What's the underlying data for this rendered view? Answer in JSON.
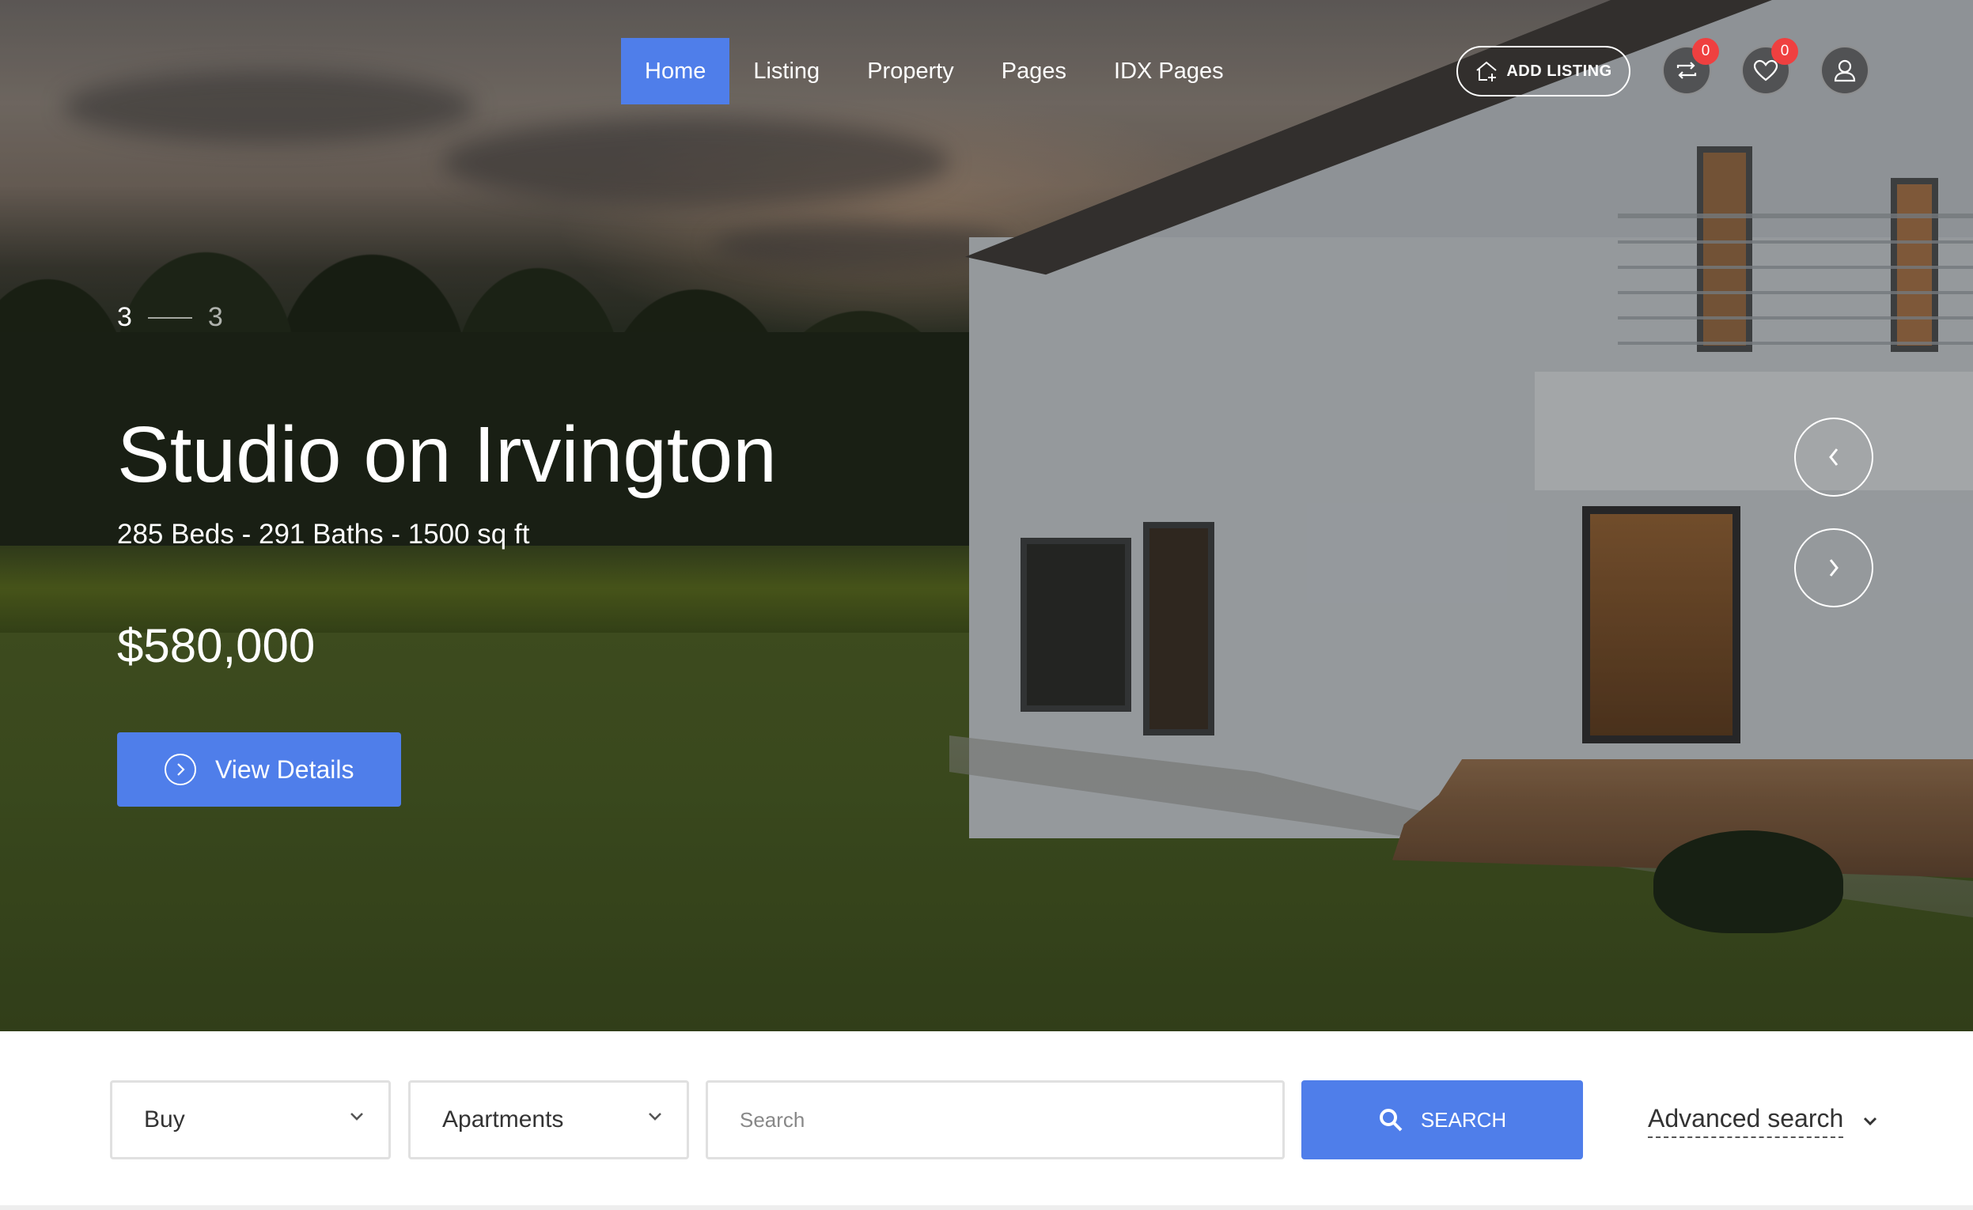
{
  "nav": {
    "items": [
      {
        "label": "Home",
        "active": true
      },
      {
        "label": "Listing",
        "active": false
      },
      {
        "label": "Property",
        "active": false
      },
      {
        "label": "Pages",
        "active": false
      },
      {
        "label": "IDX Pages",
        "active": false
      }
    ],
    "add_listing_label": "ADD LISTING",
    "compare_count": "0",
    "favorites_count": "0",
    "icons": {
      "add_listing": "house-plus-icon",
      "compare": "compare-arrows-icon",
      "favorites": "heart-icon",
      "account": "user-icon"
    }
  },
  "hero": {
    "slide_current": "3",
    "slide_total": "3",
    "title": "Studio on Irvington",
    "meta": "285 Beds - 291 Baths - 1500 sq ft",
    "price": "$580,000",
    "view_details_label": "View Details",
    "prev_icon": "chevron-left-icon",
    "next_icon": "chevron-right-icon"
  },
  "search": {
    "type_value": "Buy",
    "category_value": "Apartments",
    "input_placeholder": "Search",
    "search_button_label": "SEARCH",
    "advanced_label": "Advanced search"
  },
  "colors": {
    "accent": "#4f7eea",
    "badge": "#ef4040",
    "border": "#e0e0e0"
  }
}
